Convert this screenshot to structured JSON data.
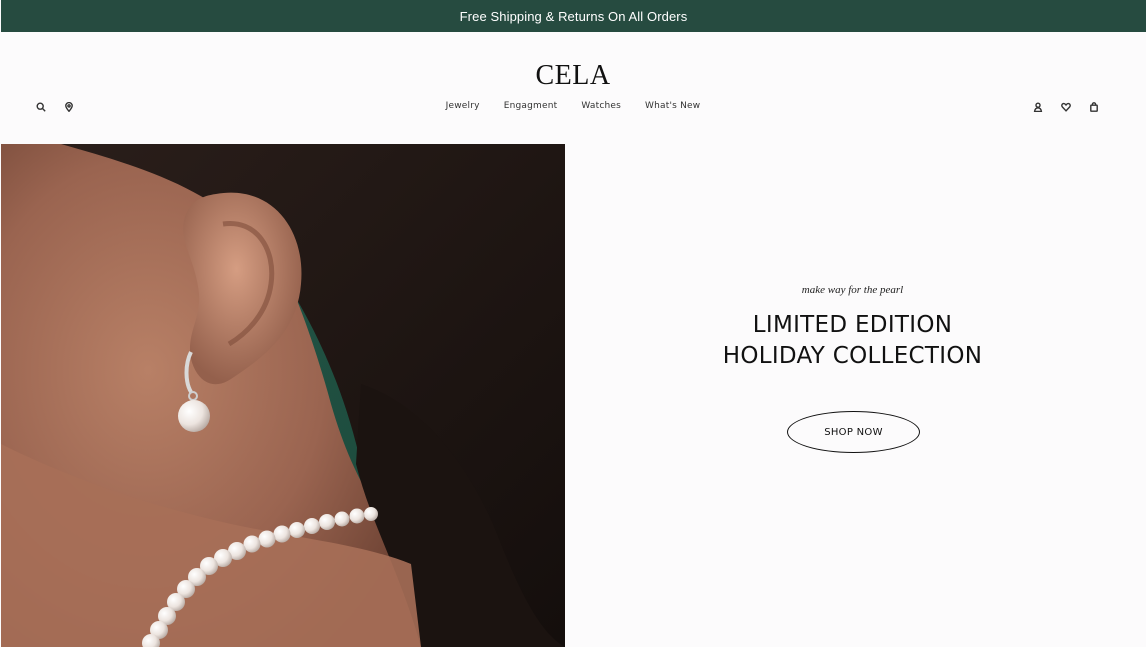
{
  "promo": {
    "text": "Free Shipping & Returns On All Orders"
  },
  "header": {
    "logo": "CELA",
    "nav": [
      "Jewelry",
      "Engagment",
      "Watches",
      "What's New"
    ],
    "left_icons": [
      "search-icon",
      "location-pin-icon"
    ],
    "right_icons": [
      "account-icon",
      "wishlist-heart-icon",
      "shopping-bag-icon"
    ]
  },
  "hero": {
    "tagline": "make way for the pearl",
    "headline_line1": "LIMITED EDITION",
    "headline_line2": "HOLIDAY COLLECTION",
    "cta": "SHOP NOW"
  },
  "colors": {
    "promo_bg": "#264b40",
    "page_bg": "#fcfbfc",
    "text": "#111111"
  }
}
